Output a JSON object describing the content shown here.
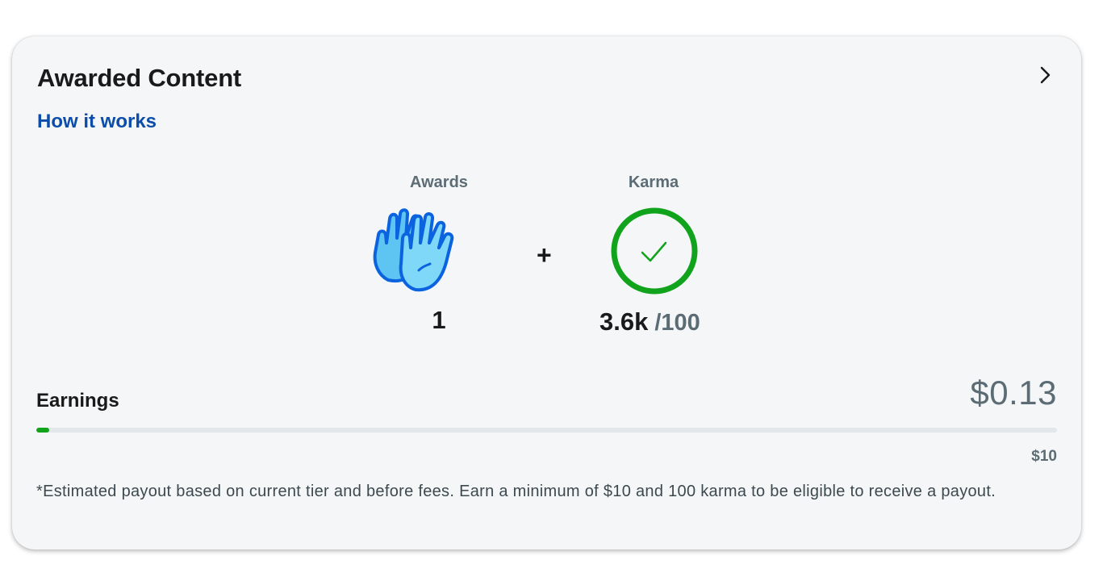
{
  "card": {
    "title": "Awarded Content",
    "how_it_works_link": "How it works"
  },
  "metrics": {
    "awards": {
      "label": "Awards",
      "value": "1",
      "icon": "high-five-hands-icon"
    },
    "operator": "+",
    "karma": {
      "label": "Karma",
      "value": "3.6k",
      "threshold": "/100",
      "icon": "check-circle-icon"
    }
  },
  "earnings": {
    "label": "Earnings",
    "amount": "$0.13",
    "goal": "$10",
    "progress_fraction": 0.013
  },
  "footnote": "*Estimated payout based on current tier and before fees. Earn a minimum of $10 and 100 karma to be eligible to receive a payout.",
  "colors": {
    "link": "#0b4da8",
    "progress": "#10a31b",
    "check_ring": "#10a31b",
    "hands_fill": "#5ec4f2",
    "hands_outline": "#0b63e0"
  }
}
